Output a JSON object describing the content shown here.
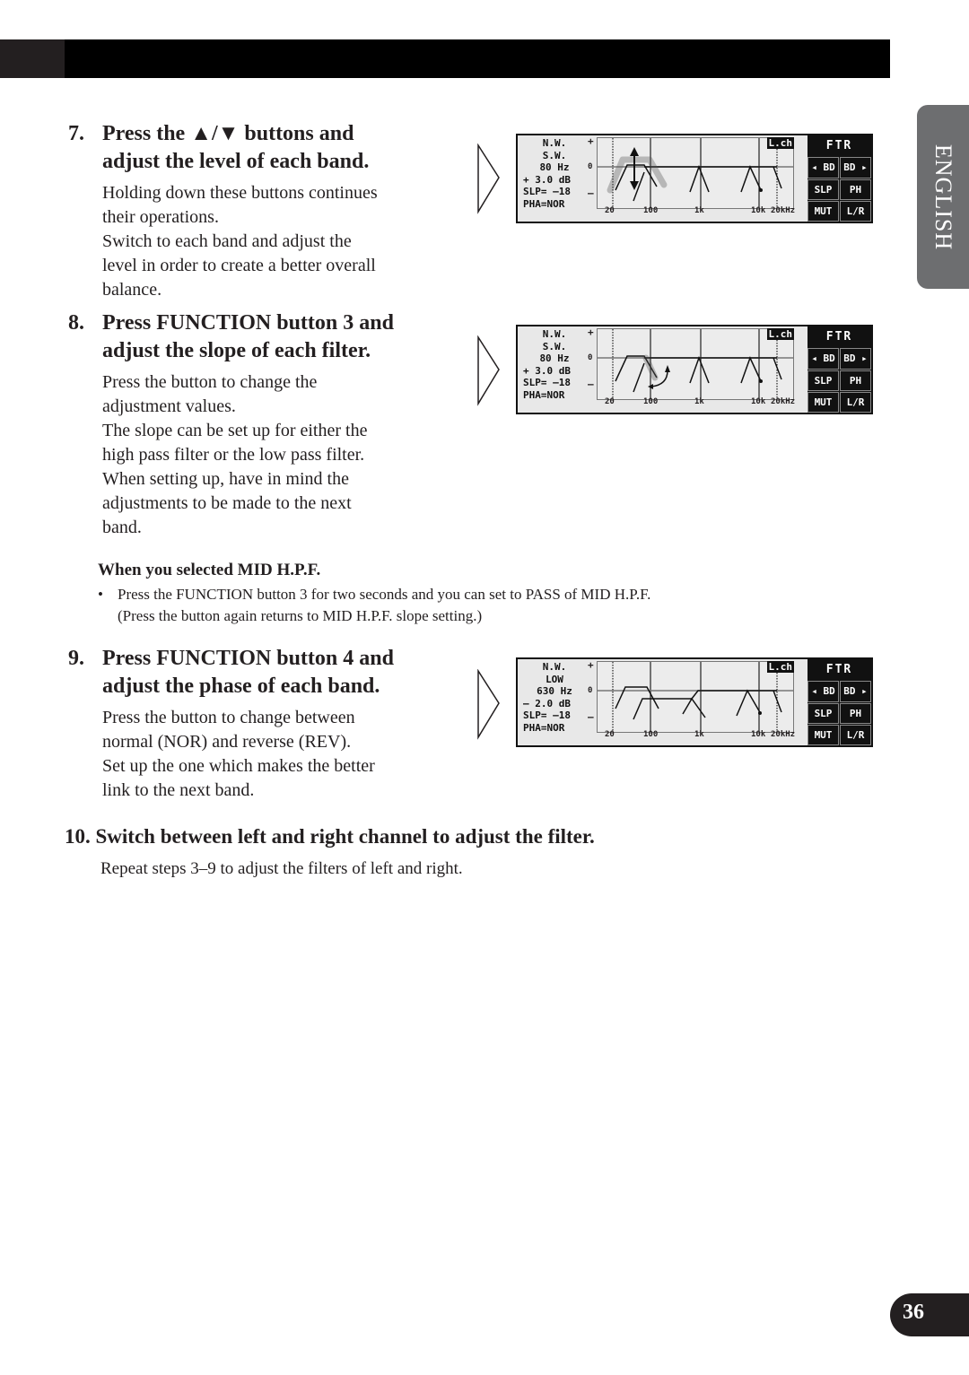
{
  "header": {
    "language_tab": "ENGLISH",
    "page_number": "36"
  },
  "steps": [
    {
      "number": "7.",
      "heading_line1": "Press the ▲/▼ buttons and",
      "heading_line2": "adjust the level of each band.",
      "body": [
        "Holding down these buttons continues",
        "their operations.",
        "Switch to each band and adjust the",
        "level in order to create a better overall",
        "balance."
      ]
    },
    {
      "number": "8.",
      "heading_line1": "Press FUNCTION button 3 and",
      "heading_line2": "adjust the slope of each filter.",
      "body": [
        "Press the button to change the",
        "adjustment values.",
        "The slope can be set up for either the",
        "high pass filter or the low pass filter.",
        "When setting up, have in mind the",
        "adjustments to be made to the next",
        "band."
      ]
    },
    {
      "number": "9.",
      "heading_line1": "Press FUNCTION button 4 and",
      "heading_line2": "adjust the phase of each band.",
      "body": [
        "Press the button to change between",
        "normal (NOR) and reverse (REV).",
        "Set up the one which makes the better",
        "link to the next band."
      ]
    }
  ],
  "note": {
    "heading": "When you selected MID H.P.F.",
    "bullet": "•",
    "line1": "Press the FUNCTION button 3 for two seconds and you can set to PASS of MID H.P.F.",
    "line2": "(Press the button again returns to MID H.P.F. slope setting.)"
  },
  "step10": {
    "heading": "10. Switch between left and right channel to adjust the filter.",
    "body": "Repeat steps 3–9 to adjust the filters of left and right."
  },
  "lcd_common": {
    "channel": "L.ch",
    "plus": "+",
    "zero": "0",
    "minus": "–",
    "x_ticks": [
      "20",
      "100",
      "1k",
      "10k",
      "20kHz"
    ],
    "buttons": {
      "title": "FTR",
      "bd_left": "◂ BD",
      "bd_right": "BD ▸",
      "slp": "SLP",
      "ph": "PH",
      "mut": "MUT",
      "lr": "L/R"
    }
  },
  "displays": [
    {
      "line1": "N.W.",
      "line2": "S.W.",
      "freq": "80 Hz",
      "level": "+ 3.0 dB",
      "slope": "SLP= –18",
      "phase": "PHA=NOR",
      "indicator": "level-updown"
    },
    {
      "line1": "N.W.",
      "line2": "S.W.",
      "freq": "80 Hz",
      "level": "+ 3.0 dB",
      "slope": "SLP= –18",
      "phase": "PHA=NOR",
      "indicator": "slope-rotate"
    },
    {
      "line1": "N.W.",
      "line2": "LOW",
      "freq": "630 Hz",
      "level": "– 2.0 dB",
      "slope": "SLP= –18",
      "phase": "PHA=NOR",
      "indicator": "none"
    }
  ]
}
